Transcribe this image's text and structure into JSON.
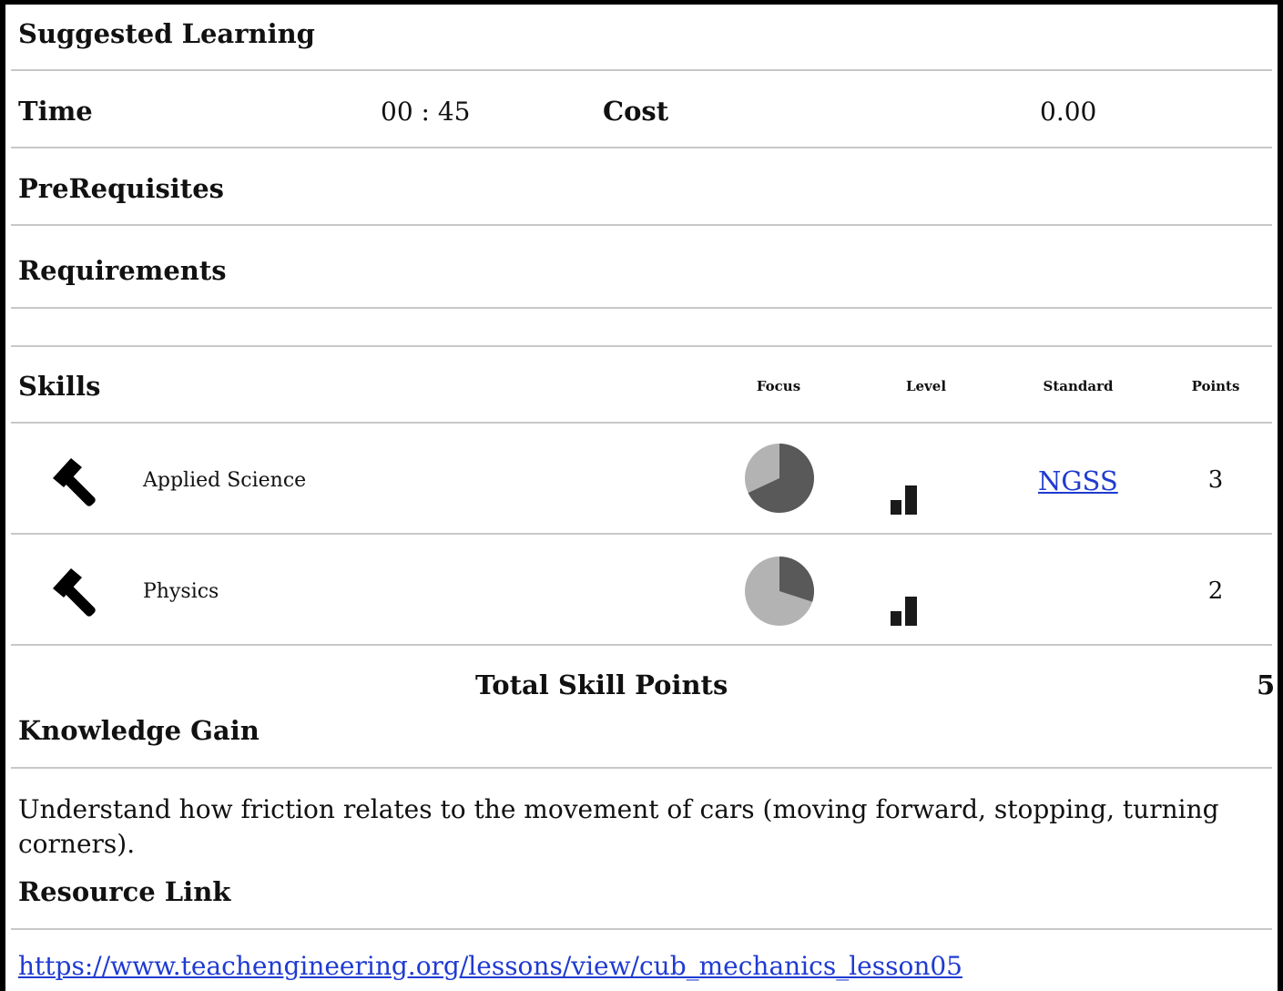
{
  "header": {
    "title": "Suggested Learning"
  },
  "meta": {
    "time_label": "Time",
    "time_value": "00 : 45",
    "cost_label": "Cost",
    "cost_value": "0.00"
  },
  "prerequisites": {
    "title": "PreRequisites"
  },
  "requirements": {
    "title": "Requirements"
  },
  "skills": {
    "title": "Skills",
    "columns": [
      "Focus",
      "Level",
      "Standard",
      "Points"
    ],
    "items": [
      {
        "icon": "hammer-icon",
        "name": "Applied Science",
        "focus_fraction": 0.68,
        "level_bars": 2,
        "standard": "NGSS",
        "points": "3"
      },
      {
        "icon": "hammer-icon",
        "name": "Physics",
        "focus_fraction": 0.3,
        "level_bars": 2,
        "standard": "",
        "points": "2"
      }
    ],
    "total_label": "Total Skill Points",
    "total_value": "5"
  },
  "knowledge": {
    "title": "Knowledge Gain",
    "text": "Understand how friction relates to the movement of cars (moving forward, stopping, turning corners)."
  },
  "resource": {
    "title": "Resource Link",
    "url": "https://www.teachengineering.org/lessons/view/cub_mechanics_lesson05"
  },
  "colors": {
    "pie_dark": "#595959",
    "pie_light": "#b3b3b3",
    "link": "#1f3bd1"
  }
}
